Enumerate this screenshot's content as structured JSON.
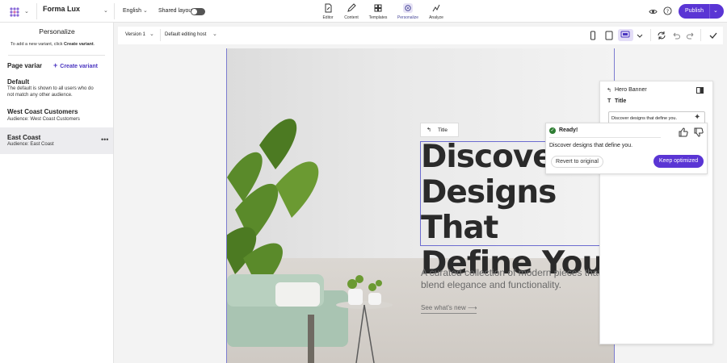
{
  "topbar": {
    "site_name": "Forma Lux",
    "language": "English",
    "shared_layout_label": "Shared layout",
    "modes": [
      {
        "label": "Editor",
        "icon": "editor-icon"
      },
      {
        "label": "Content",
        "icon": "content-icon"
      },
      {
        "label": "Templates",
        "icon": "templates-icon"
      },
      {
        "label": "Personalize",
        "icon": "personalize-icon",
        "active": true
      },
      {
        "label": "Analyze",
        "icon": "analyze-icon"
      }
    ],
    "publish_label": "Publish",
    "accent_color": "#5a35d4"
  },
  "left_panel": {
    "title": "Personalize",
    "hint_prefix": "To add a new variant, click ",
    "hint_link": "Create variant",
    "hint_suffix": ".",
    "page_variants_title": "Page variants",
    "create_variant_label": "Create variant",
    "variants": [
      {
        "name": "Default",
        "description": "The default is shown to all users who do not match any other audience."
      },
      {
        "name": "West Coast Customers",
        "description": "Audience: West Coast Customers"
      },
      {
        "name": "East Coast",
        "description": "Audience: East Coast",
        "selected": true
      }
    ]
  },
  "canvas_toolbar": {
    "version": "Version 1",
    "editing_host": "Default editing host"
  },
  "canvas": {
    "title_tag": "Title",
    "heading": "Discover Designs That Define You.",
    "subheading": "A curated collection of modern pieces that blend elegance and functionality.",
    "link": "See what's new"
  },
  "right_panel": {
    "component": "Hero Banner",
    "field_label": "Title",
    "field_value": "Discover designs that define you.",
    "ready_label": "Ready!",
    "suggestion": "Discover designs that define you.",
    "revert_label": "Revert to original",
    "keep_label": "Keep optimized"
  }
}
